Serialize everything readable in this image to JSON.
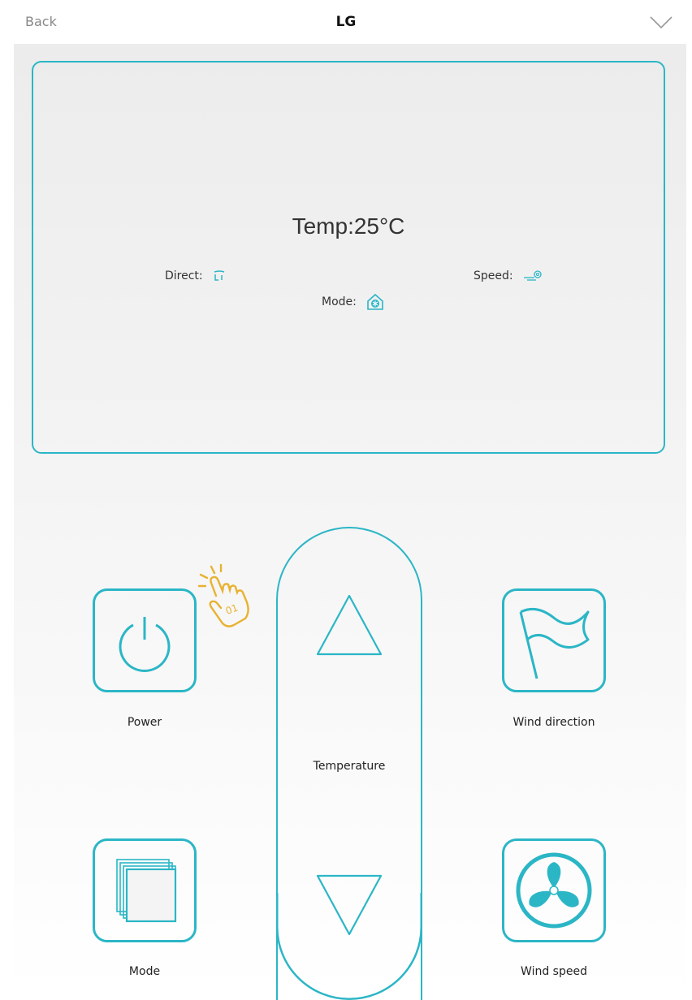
{
  "topbar": {
    "back_label": "Back",
    "title": "LG"
  },
  "display": {
    "temperature": "Temp:25°C",
    "direct_label": "Direct:",
    "speed_label": "Speed:",
    "mode_label": "Mode:"
  },
  "controls": {
    "power_label": "Power",
    "wind_direction_label": "Wind direction",
    "temperature_label": "Temperature",
    "mode_label": "Mode",
    "wind_speed_label": "Wind speed"
  },
  "colors": {
    "accent": "#2bb6c6",
    "hint": "#e8b230"
  },
  "icons": [
    "chevron-down-icon",
    "swing-icon",
    "wind-icon",
    "snowflake-home-icon",
    "power-icon",
    "flag-icon",
    "layers-icon",
    "fan-icon",
    "up-triangle-icon",
    "down-triangle-icon",
    "tap-hand-icon"
  ]
}
